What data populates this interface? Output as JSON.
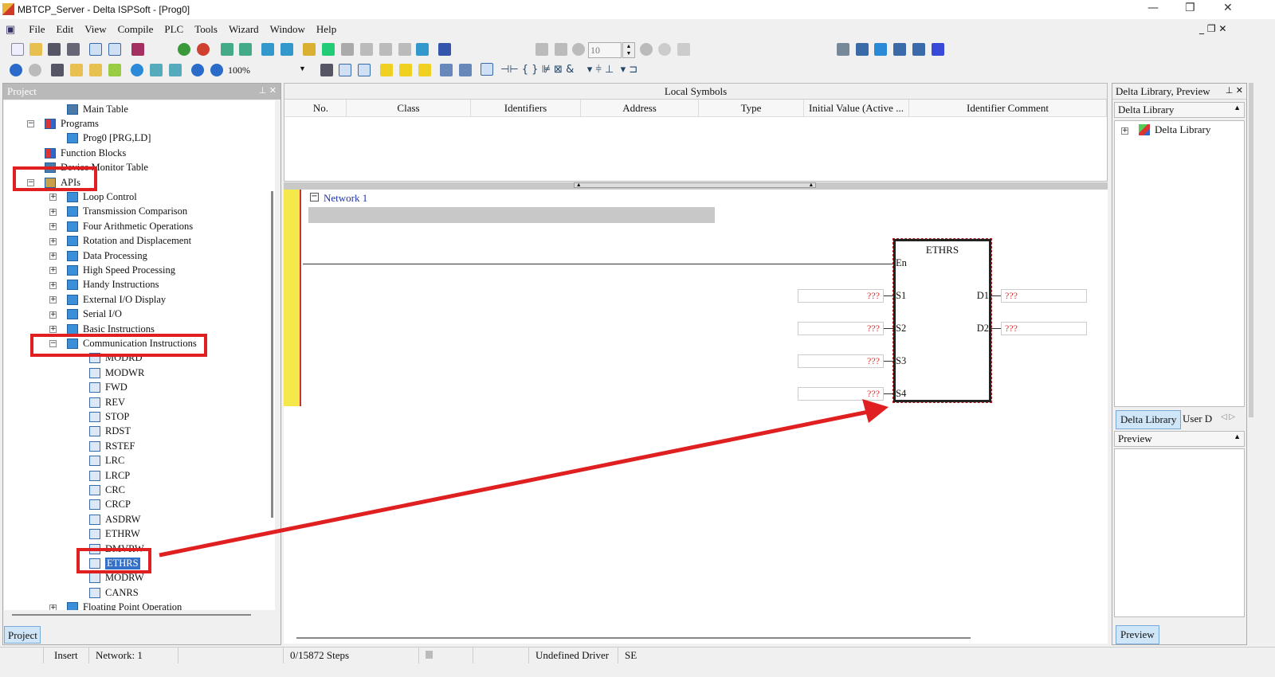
{
  "window": {
    "title": "MBTCP_Server - Delta ISPSoft - [Prog0]",
    "min": "—",
    "restore": "❐",
    "close": "✕"
  },
  "menu": [
    "File",
    "Edit",
    "View",
    "Compile",
    "PLC",
    "Tools",
    "Wizard",
    "Window",
    "Help"
  ],
  "toolbar": {
    "zoom": "100%",
    "step_value": "10"
  },
  "project_panel": {
    "title": "Project",
    "tab": "Project",
    "tree": [
      {
        "label": "Main Table",
        "level": 2,
        "icon": "main-table-icon"
      },
      {
        "label": "Programs",
        "level": 1,
        "icon": "programs-icon",
        "expander": "−"
      },
      {
        "label": "Prog0 [PRG,LD]",
        "level": 2,
        "icon": "program-icon"
      },
      {
        "label": "Function Blocks",
        "level": 1,
        "icon": "function-blocks-icon"
      },
      {
        "label": "Device Monitor Table",
        "level": 1,
        "icon": "monitor-icon"
      },
      {
        "label": "APIs",
        "level": 1,
        "icon": "apis-icon",
        "expander": "−"
      },
      {
        "label": "Loop Control",
        "level": 2,
        "icon": "api-group-icon",
        "expander": "+"
      },
      {
        "label": "Transmission Comparison",
        "level": 2,
        "icon": "api-group-icon",
        "expander": "+"
      },
      {
        "label": "Four Arithmetic Operations",
        "level": 2,
        "icon": "api-group-icon",
        "expander": "+"
      },
      {
        "label": "Rotation and Displacement",
        "level": 2,
        "icon": "api-group-icon",
        "expander": "+"
      },
      {
        "label": "Data Processing",
        "level": 2,
        "icon": "api-group-icon",
        "expander": "+"
      },
      {
        "label": "High Speed Processing",
        "level": 2,
        "icon": "api-group-icon",
        "expander": "+"
      },
      {
        "label": "Handy Instructions",
        "level": 2,
        "icon": "api-group-icon",
        "expander": "+"
      },
      {
        "label": "External I/O Display",
        "level": 2,
        "icon": "api-group-icon",
        "expander": "+"
      },
      {
        "label": "Serial I/O",
        "level": 2,
        "icon": "api-group-icon",
        "expander": "+"
      },
      {
        "label": "Basic Instructions",
        "level": 2,
        "icon": "api-group-icon",
        "expander": "+"
      },
      {
        "label": "Communication Instructions",
        "level": 2,
        "icon": "api-group-icon",
        "expander": "−"
      },
      {
        "label": "MODRD",
        "level": 3,
        "icon": "instruction-icon"
      },
      {
        "label": "MODWR",
        "level": 3,
        "icon": "instruction-icon"
      },
      {
        "label": "FWD",
        "level": 3,
        "icon": "instruction-icon"
      },
      {
        "label": "REV",
        "level": 3,
        "icon": "instruction-icon"
      },
      {
        "label": "STOP",
        "level": 3,
        "icon": "instruction-icon"
      },
      {
        "label": "RDST",
        "level": 3,
        "icon": "instruction-icon"
      },
      {
        "label": "RSTEF",
        "level": 3,
        "icon": "instruction-icon"
      },
      {
        "label": "LRC",
        "level": 3,
        "icon": "instruction-icon"
      },
      {
        "label": "LRCP",
        "level": 3,
        "icon": "instruction-icon"
      },
      {
        "label": "CRC",
        "level": 3,
        "icon": "instruction-icon"
      },
      {
        "label": "CRCP",
        "level": 3,
        "icon": "instruction-icon"
      },
      {
        "label": "ASDRW",
        "level": 3,
        "icon": "instruction-icon"
      },
      {
        "label": "ETHRW",
        "level": 3,
        "icon": "instruction-icon"
      },
      {
        "label": "DMVRW",
        "level": 3,
        "icon": "instruction-icon"
      },
      {
        "label": "ETHRS",
        "level": 3,
        "icon": "instruction-icon",
        "selected": true
      },
      {
        "label": "MODRW",
        "level": 3,
        "icon": "instruction-icon"
      },
      {
        "label": "CANRS",
        "level": 3,
        "icon": "instruction-icon"
      },
      {
        "label": "Floating Point Operation",
        "level": 2,
        "icon": "api-group-icon",
        "expander": "+"
      }
    ]
  },
  "local_symbols": {
    "title": "Local Symbols",
    "columns": [
      "No.",
      "Class",
      "Identifiers",
      "Address",
      "Type",
      "Initial Value (Active ...",
      "Identifier Comment"
    ]
  },
  "ladder": {
    "network": "Network 1",
    "block": {
      "name": "ETHRS",
      "enable": "En",
      "inputs": [
        {
          "pin": "S1",
          "value": "???"
        },
        {
          "pin": "S2",
          "value": "???"
        },
        {
          "pin": "S3",
          "value": "???"
        },
        {
          "pin": "S4",
          "value": "???"
        }
      ],
      "outputs": [
        {
          "pin": "D1",
          "value": "???"
        },
        {
          "pin": "D2",
          "value": "???"
        }
      ]
    }
  },
  "library_panel": {
    "title": "Delta Library, Preview",
    "section": "Delta Library",
    "root": "Delta Library",
    "tabs": [
      "Delta Library",
      "User D"
    ],
    "preview": "Preview",
    "preview_tab": "Preview"
  },
  "statusbar": [
    "",
    "Insert",
    "Network: 1",
    "",
    "0/15872 Steps",
    "",
    "",
    "Undefined Driver",
    "SE"
  ],
  "colors": {
    "annotation": "#e02020",
    "selection": "#3470c8",
    "rail": "#f5e84a"
  }
}
